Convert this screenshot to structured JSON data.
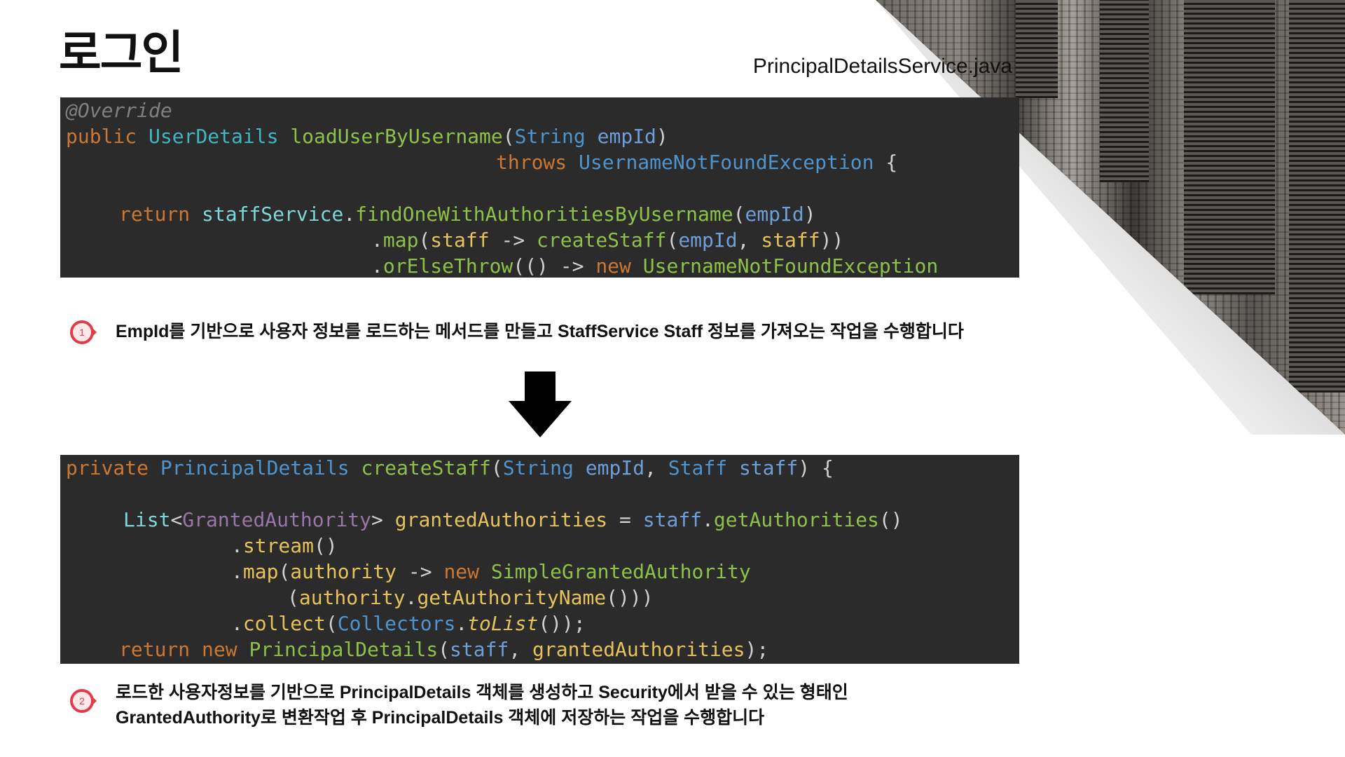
{
  "slide": {
    "title": "로그인",
    "file_name": "PrincipalDetailsService.java"
  },
  "code_block_1": {
    "l1": "@Override",
    "l2": {
      "kw": "public",
      "type": "UserDetails",
      "fn": "loadUserByUsername",
      "open": "(",
      "param_type": "String",
      "param": "empId",
      "close": ")"
    },
    "l3": {
      "kw": "throws",
      "type": "UsernameNotFoundException",
      "brace": "{"
    },
    "l4": {
      "kw": "return",
      "obj": "staffService",
      "dot": ".",
      "fn": "findOneWithAuthoritiesByUsername",
      "open": "(",
      "arg": "empId",
      "close": ")"
    },
    "l5": {
      "dot": ".",
      "fn": "map",
      "open": "(",
      "var": "staff",
      "arrow": " -> ",
      "fn2": "createStaff",
      "open2": "(",
      "arg": "empId",
      "comma": ", ",
      "arg2": "staff",
      "close": "))"
    },
    "l6": {
      "dot": ".",
      "fn": "orElseThrow",
      "open": "(() -> ",
      "kw": "new",
      "fn2": "UsernameNotFoundException"
    }
  },
  "note_1": {
    "number": "1",
    "text": "EmpId를 기반으로 사용자 정보를 로드하는 메서드를 만들고 StaffService Staff 정보를 가져오는 작업을 수행합니다"
  },
  "code_block_2": {
    "l1": {
      "kw": "private",
      "type": "PrincipalDetails",
      "fn": "createStaff",
      "open": "(",
      "param_type": "String",
      "param": "empId",
      "comma": ", ",
      "param_type2": "Staff",
      "param2": "staff",
      "close": ") {"
    },
    "l2": {
      "type": "List",
      "lt": "<",
      "generic": "GrantedAuthority",
      "gt": ">",
      "var": "grantedAuthorities",
      "eq": " = ",
      "obj": "staff",
      "dot": ".",
      "fn": "getAuthorities",
      "call": "()"
    },
    "l3": {
      "dot": ".",
      "fn": "stream",
      "call": "()"
    },
    "l4": {
      "dot": ".",
      "fn": "map",
      "open": "(",
      "var": "authority",
      "arrow": " -> ",
      "kw": "new",
      "fn2": "SimpleGrantedAuthority"
    },
    "l5": {
      "open": "(",
      "var": "authority",
      "dot": ".",
      "fn": "getAuthorityName",
      "close": "()))"
    },
    "l6": {
      "dot": ".",
      "fn": "collect",
      "open": "(",
      "cls": "Collectors",
      "dot2": ".",
      "fn2": "toList",
      "close": "());"
    },
    "l7": {
      "kw": "return",
      "kw2": "new",
      "fn": "PrincipalDetails",
      "open": "(",
      "arg": "staff",
      "comma": ", ",
      "arg2": "grantedAuthorities",
      "close": ");"
    }
  },
  "note_2": {
    "number": "2",
    "line1": "로드한 사용자정보를 기반으로 PrincipalDetails 객체를 생성하고 Security에서 받을 수 있는 형태인",
    "line2": "GrantedAuthority로 변환작업 후 PrincipalDetails 객체에 저장하는 작업을 수행합니다"
  },
  "colors": {
    "code_bg": "#2b2b2b",
    "badge_red": "#e03c4b",
    "keyword": "#cc7832",
    "function": "#8dc149"
  }
}
